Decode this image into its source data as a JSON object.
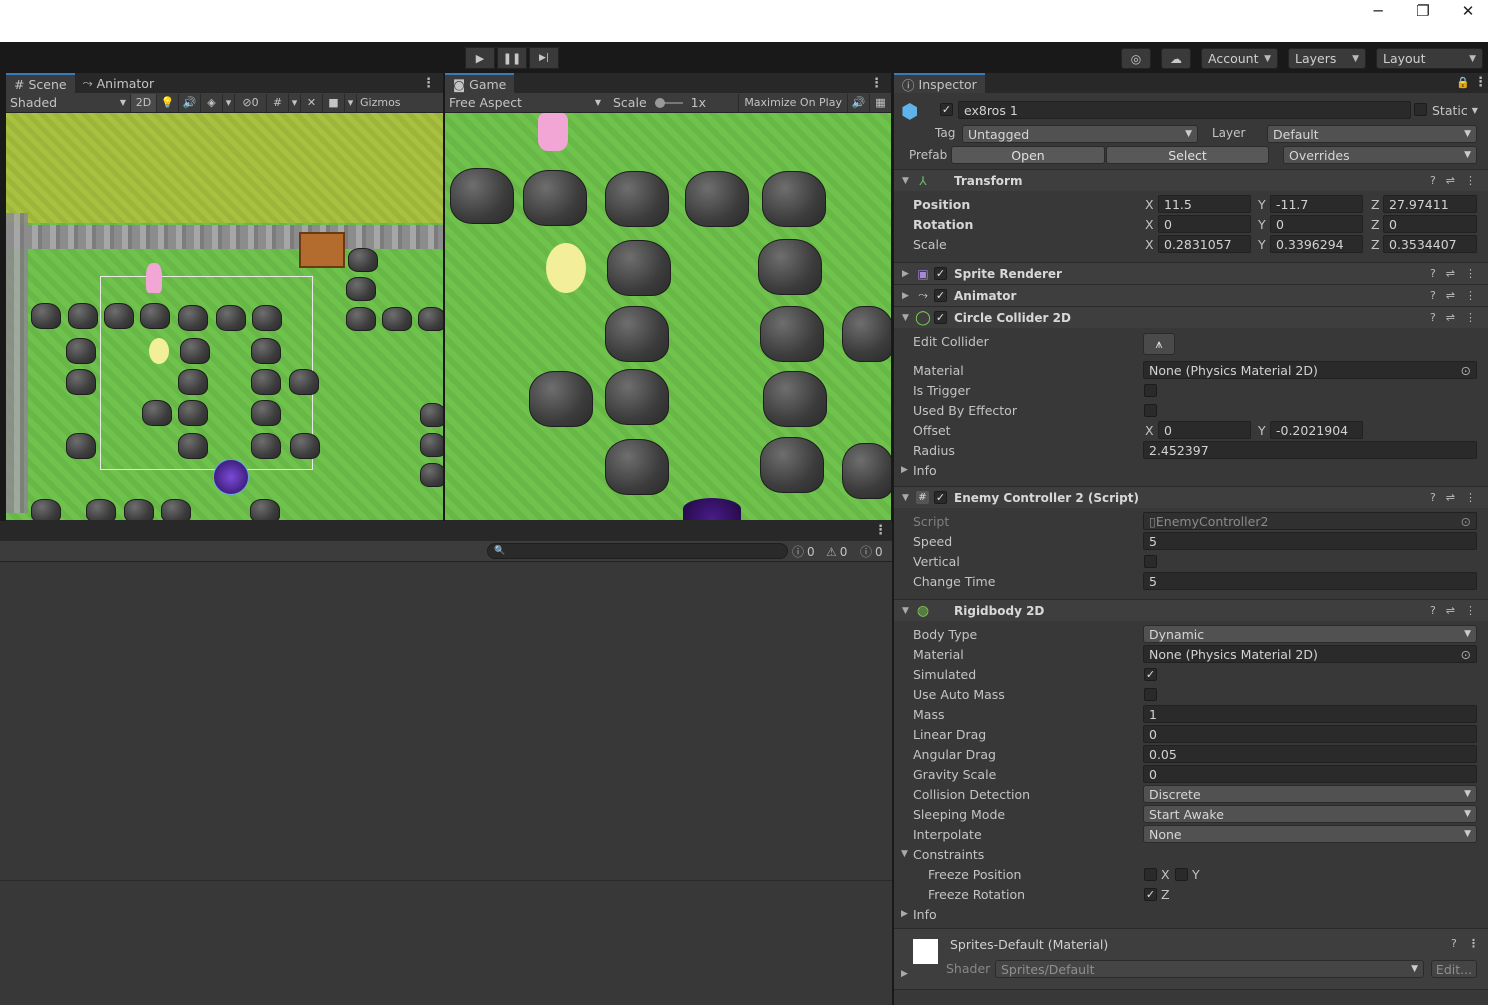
{
  "window": {
    "minimize": "─",
    "restore": "❐",
    "close": "✕"
  },
  "toolbar": {
    "play": "▶",
    "pause": "❚❚",
    "step": "▶|",
    "account": "Account",
    "layers": "Layers",
    "layout": "Layout"
  },
  "scene_panel": {
    "tabs": [
      {
        "label": "Scene"
      },
      {
        "label": "Animator"
      }
    ],
    "shading": "Shaded",
    "mode_2d": "2D",
    "hidden_count": "0",
    "gizmos": "Gizmos"
  },
  "game_panel": {
    "tab": "Game",
    "aspect": "Free Aspect",
    "scale_label": "Scale",
    "scale_value": "1x",
    "maximize": "Maximize On Play"
  },
  "console": {
    "search_placeholder": "",
    "log_count": "0",
    "warning_count": "0",
    "error_count": "0"
  },
  "inspector": {
    "tab": "Inspector",
    "object_name": "ex8ros 1",
    "static_label": "Static",
    "tag_label": "Tag",
    "tag_value": "Untagged",
    "layer_label": "Layer",
    "layer_value": "Default",
    "prefab_label": "Prefab",
    "prefab_open": "Open",
    "prefab_select": "Select",
    "prefab_overrides": "Overrides",
    "transform": {
      "title": "Transform",
      "position_label": "Position",
      "pos_x": "11.5",
      "pos_y": "-11.7",
      "pos_z": "27.97411",
      "rotation_label": "Rotation",
      "rot_x": "0",
      "rot_y": "0",
      "rot_z": "0",
      "scale_label": "Scale",
      "scale_x": "0.2831057",
      "scale_y": "0.3396294",
      "scale_z": "0.3534407"
    },
    "sprite_renderer": "Sprite Renderer",
    "animator": "Animator",
    "circle_collider": {
      "title": "Circle Collider 2D",
      "edit_collider": "Edit Collider",
      "material_label": "Material",
      "material_value": "None (Physics Material 2D)",
      "is_trigger": "Is Trigger",
      "used_by_effector": "Used By Effector",
      "offset_label": "Offset",
      "offset_x": "0",
      "offset_y": "-0.2021904",
      "radius_label": "Radius",
      "radius_value": "2.452397",
      "info": "Info"
    },
    "enemy_controller": {
      "title": "Enemy Controller 2 (Script)",
      "script_label": "Script",
      "script_value": "EnemyController2",
      "speed_label": "Speed",
      "speed_value": "5",
      "vertical_label": "Vertical",
      "change_time_label": "Change Time",
      "change_time_value": "5"
    },
    "rigidbody": {
      "title": "Rigidbody 2D",
      "body_type_label": "Body Type",
      "body_type_value": "Dynamic",
      "material_label": "Material",
      "material_value": "None (Physics Material 2D)",
      "simulated_label": "Simulated",
      "use_auto_mass_label": "Use Auto Mass",
      "mass_label": "Mass",
      "mass_value": "1",
      "linear_drag_label": "Linear Drag",
      "linear_drag_value": "0",
      "angular_drag_label": "Angular Drag",
      "angular_drag_value": "0.05",
      "gravity_scale_label": "Gravity Scale",
      "gravity_scale_value": "0",
      "collision_detection_label": "Collision Detection",
      "collision_detection_value": "Discrete",
      "sleeping_mode_label": "Sleeping Mode",
      "sleeping_mode_value": "Start Awake",
      "interpolate_label": "Interpolate",
      "interpolate_value": "None",
      "constraints_label": "Constraints",
      "freeze_position_label": "Freeze Position",
      "freeze_rotation_label": "Freeze Rotation",
      "axis_x": "X",
      "axis_y": "Y",
      "axis_z": "Z",
      "info": "Info"
    },
    "material": {
      "title": "Sprites-Default (Material)",
      "shader_label": "Shader",
      "shader_value": "Sprites/Default",
      "edit": "Edit..."
    }
  }
}
